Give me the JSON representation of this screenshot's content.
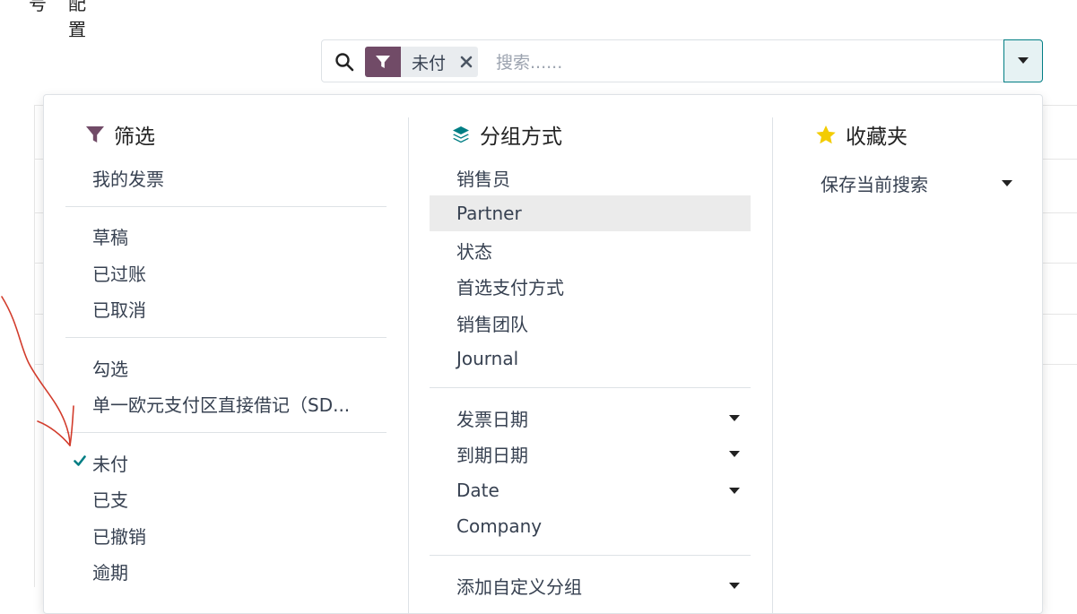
{
  "topnav": {
    "fragment": "号",
    "label": "配置"
  },
  "search": {
    "facet_label": "未付",
    "placeholder": "搜索......"
  },
  "filters": {
    "title": "筛选",
    "items": [
      "我的发票",
      "草稿",
      "已过账",
      "已取消",
      "勾选",
      "单一欧元支付区直接借记（SD...",
      "未付",
      "已支",
      "已撤销",
      "逾期"
    ],
    "checked": "未付"
  },
  "groupby": {
    "title": "分组方式",
    "items": [
      "销售员",
      "Partner",
      "状态",
      "首选支付方式",
      "销售团队",
      "Journal"
    ],
    "date_items": [
      "发票日期",
      "到期日期",
      "Date"
    ],
    "company": "Company",
    "custom_group": "添加自定义分组"
  },
  "favorites": {
    "title": "收藏夹",
    "save_current": "保存当前搜索"
  },
  "colors": {
    "brand": "#714b67",
    "accent": "#017e84",
    "star": "#f3cc00",
    "annotation": "#d23c2c"
  }
}
